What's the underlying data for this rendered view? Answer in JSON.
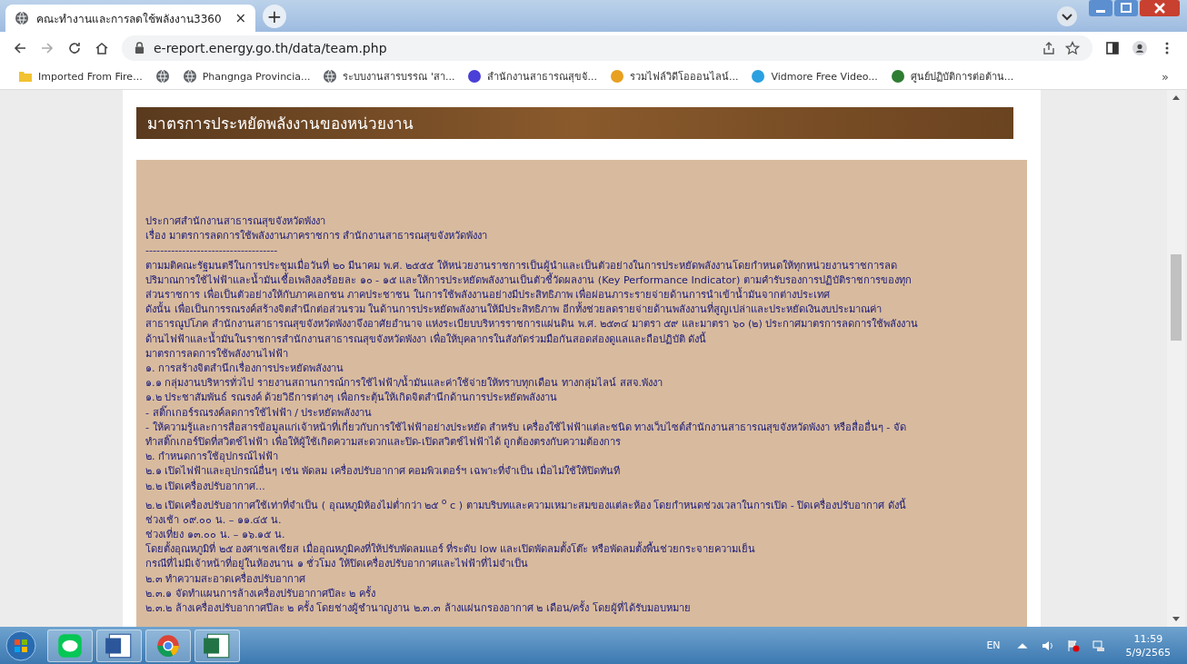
{
  "browser": {
    "tab": {
      "title": "คณะทำงานและการลดใช้พลังงาน3360",
      "close": "×",
      "new_tab": "+"
    },
    "address": "e-report.energy.go.th/data/team.php",
    "bookmarks": [
      {
        "kind": "folder",
        "label": "Imported From Fire..."
      },
      {
        "kind": "globe"
      },
      {
        "kind": "globe",
        "label": "Phangnga Provincia..."
      },
      {
        "kind": "globe",
        "label": "ระบบงานสารบรรณ 'สา..."
      },
      {
        "kind": "site",
        "color": "#4a3fd6",
        "label": "สำนักงานสาธารณสุขจั..."
      },
      {
        "kind": "site",
        "color": "#e8a020",
        "label": "รวมไฟล์วิดีโอออนไลน์..."
      },
      {
        "kind": "site",
        "color": "#2aa0e0",
        "label": "Vidmore Free Video..."
      },
      {
        "kind": "site",
        "color": "#2e7d32",
        "label": "ศูนย์ปฏิบัติการต่อต้าน..."
      }
    ],
    "more": "»"
  },
  "page": {
    "heading": "มาตรการประหยัดพลังงานของหน่วยงาน",
    "lines": [
      "ประกาศสำนักงานสาธารณสุขจังหวัดพังงา",
      "เรื่อง มาตรการลดการใช้พลังงานภาคราชการ สำนักงานสาธารณสุขจังหวัดพังงา",
      "------------------------------------",
      "ตามมติคณะรัฐมนตรีในการประชุมเมื่อวันที่ ๒๐ มีนาคม พ.ศ. ๒๕๕๕ ให้หน่วยงานราชการเป็นผู้นำและเป็นตัวอย่างในการประหยัดพลังงานโดยกำหนดให้ทุกหน่วยงานราชการลด",
      "ปริมาณการใช้ไฟฟ้าและน้ำมันเชื้อเพลิงลงร้อยละ ๑๐ - ๑๕ และให้การประหยัดพลังงานเป็นตัวชี้วัดผลงาน (Key Performance Indicator) ตามคำรับรองการปฏิบัติราชการของทุก",
      "ส่วนราชการ เพื่อเป็นตัวอย่างให้กับภาคเอกชน ภาคประชาชน ในการใช้พลังงานอย่างมีประสิทธิภาพ เพื่อผ่อนภาระรายจ่ายด้านการนำเข้าน้ำมันจากต่างประเทศ",
      "ดังนั้น เพื่อเป็นการรณรงค์สร้างจิตสำนึกต่อส่วนรวม ในด้านการประหยัดพลังงานให้มีประสิทธิภาพ อีกทั้งช่วยลดรายจ่ายด้านพลังงานที่สูญเปล่าและประหยัดเงินงบประมาณค่า",
      "สาธารณูปโภค สำนักงานสาธารณสุขจังหวัดพังงาจึงอาศัยอำนาจ แห่งระเบียบบริหารราชการแผ่นดิน พ.ศ. ๒๕๓๔ มาตรา ๕๙ และมาตรา ๖๐ (๒) ประกาศมาตรการลดการใช้พลังงาน",
      "ด้านไฟฟ้าและน้ำมันในราชการสำนักงานสาธารณสุขจังหวัดพังงา เพื่อให้บุคลากรในสังกัดร่วมมือกันสอดส่องดูแลและถือปฏิบัติ ดังนี้",
      "มาตรการลดการใช้พลังงานไฟฟ้า",
      "๑. การสร้างจิตสำนึกเรื่องการประหยัดพลังงาน",
      "๑.๑ กลุ่มงานบริหารทั่วไป รายงานสถานการณ์การใช้ไฟฟ้า/น้ำมันและค่าใช้จ่ายให้ทราบทุกเดือน ทางกลุ่มไลน์ สสจ.พังงา",
      "๑.๒ ประชาสัมพันธ์ รณรงค์ ด้วยวิธีการต่างๆ เพื่อกระตุ้นให้เกิดจิตสำนึกด้านการประหยัดพลังงาน",
      "- สติ๊กเกอร์รณรงค์ลดการใช้ไฟฟ้า / ประหยัดพลังงาน",
      "- ให้ความรู้และการสื่อสารข้อมูลแก่เจ้าหน้าที่เกี่ยวกับการใช้ไฟฟ้าอย่างประหยัด สำหรับ เครื่องใช้ไฟฟ้าแต่ละชนิด ทางเว็บไซต์สำนักงานสาธารณสุขจังหวัดพังงา หรือสื่ออื่นๆ - จัด",
      "ทำสติ๊กเกอร์ปิดที่สวิตช์ไฟฟ้า เพื่อให้ผู้ใช้เกิดความสะดวกและปิด-เปิดสวิตช์ไฟฟ้าได้ ถูกต้องตรงกับความต้องการ",
      "๒. กำหนดการใช้อุปกรณ์ไฟฟ้า",
      "๒.๑ เปิดไฟฟ้าและอุปกรณ์อื่นๆ เช่น พัดลม เครื่องปรับอากาศ คอมพิวเตอร์ฯ เฉพาะที่จำเป็น เมื่อไม่ใช้ให้ปิดทันที",
      "๒.๒ เปิดเครื่องปรับอากาศ...",
      "๒.๒ เปิดเครื่องปรับอากาศใช้เท่าที่จำเป็น ( อุณหภูมิห้องไม่ต่ำกว่า ๒๕ $^{o}$ c ) ตามบริบทและความเหมาะสมของแต่ละห้อง โดยกำหนดช่วงเวลาในการเปิด - ปิดเครื่องปรับอากาศ ดังนี้",
      "ช่วงเช้า ๐๙.๐๐ น. – ๑๑.๔๕ น.",
      "ช่วงเที่ยง ๑๓.๐๐ น. – ๑๖.๑๕ น.",
      "โดยตั้งอุณหภูมิที่ ๒๕ องศาเซลเซียส เมื่ออุณหภูมิคงที่ให้ปรับพัดลมแอร์ ที่ระดับ low และเปิดพัดลมตั้งโต๊ะ หรือพัดลมตั้งพื้นช่วยกระจายความเย็น",
      "กรณีที่ไม่มีเจ้าหน้าที่อยู่ในห้องนาน ๑ ชั่วโมง ให้ปิดเครื่องปรับอากาศและไฟฟ้าที่ไม่จำเป็น",
      "๒.๓ ทำความสะอาดเครื่องปรับอากาศ",
      "๒.๓.๑ จัดทำแผนการล้างเครื่องปรับอากาศปีละ ๒ ครั้ง",
      "๒.๓.๒ ล้างเครื่องปรับอากาศปีละ ๒ ครั้ง โดยช่างผู้ชำนาญงาน ๒.๓.๓ ล้างแผ่นกรองอากาศ ๒ เดือน/ครั้ง โดยผู้ที่ได้รับมอบหมาย"
    ]
  },
  "taskbar": {
    "language": "EN",
    "time": "11:59",
    "date": "5/9/2565"
  }
}
